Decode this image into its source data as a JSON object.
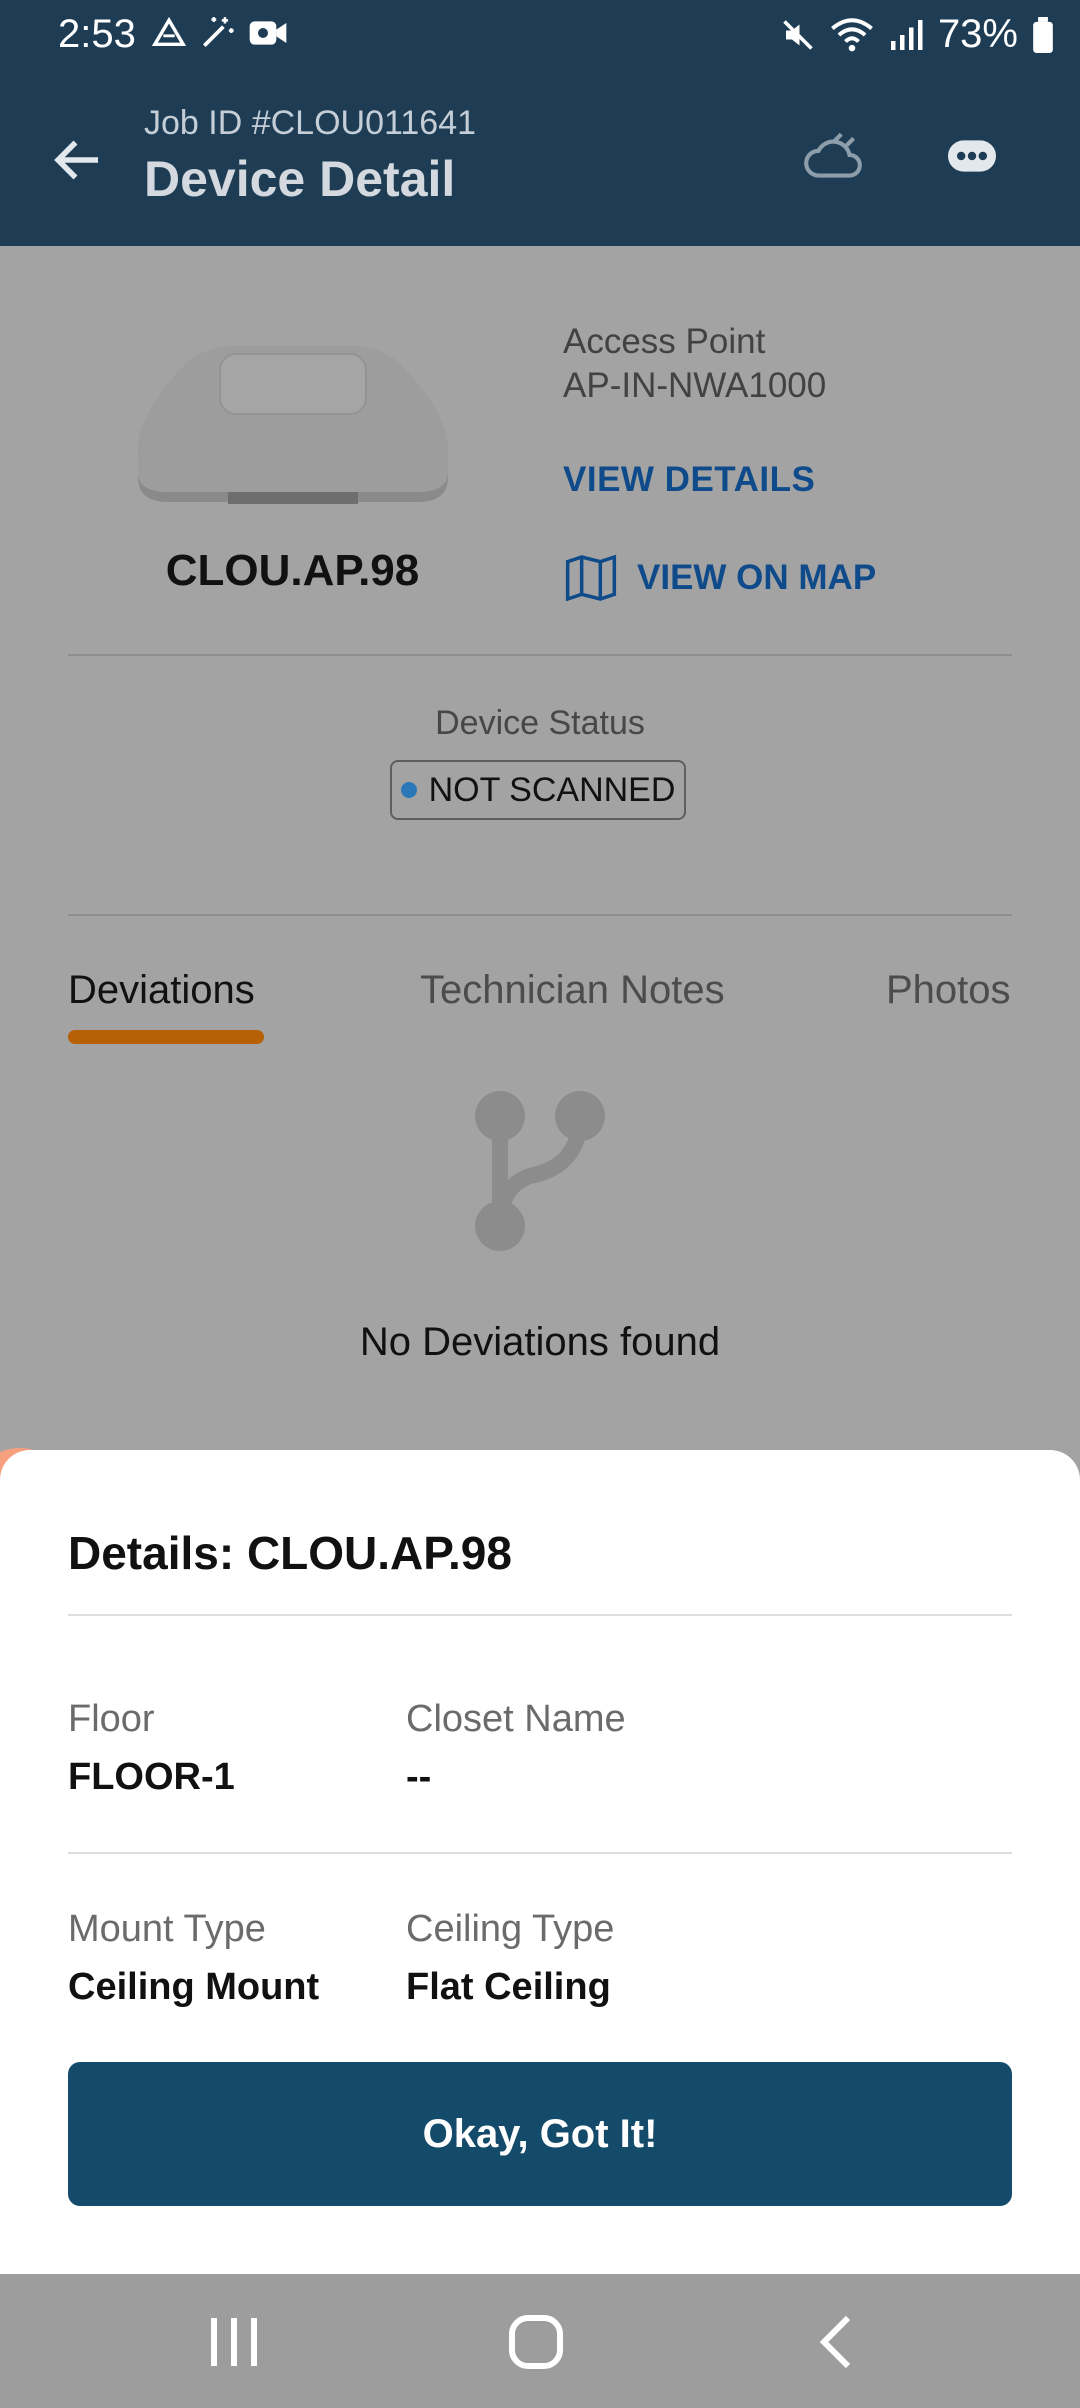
{
  "status_bar": {
    "time": "2:53",
    "battery": "73%"
  },
  "app_bar": {
    "job_id": "Job ID #CLOU011641",
    "title": "Device Detail"
  },
  "device": {
    "type": "Access Point",
    "model": "AP-IN-NWA1000",
    "name": "CLOU.AP.98",
    "view_details": "VIEW DETAILS",
    "view_on_map": "VIEW ON MAP"
  },
  "status": {
    "label": "Device Status",
    "value": "NOT SCANNED",
    "dot_color": "#2b78b8"
  },
  "tabs": [
    {
      "label": "Deviations"
    },
    {
      "label": "Technician Notes"
    },
    {
      "label": "Photos"
    }
  ],
  "empty_state": {
    "text": "No Deviations found"
  },
  "sheet": {
    "title": "Details: CLOU.AP.98",
    "fields": {
      "floor_label": "Floor",
      "floor_value": "FLOOR-1",
      "closet_label": "Closet Name",
      "closet_value": "--",
      "mount_label": "Mount Type",
      "mount_value": "Ceiling Mount",
      "ceiling_label": "Ceiling Type",
      "ceiling_value": "Flat Ceiling"
    },
    "button": "Okay, Got It!"
  },
  "colors": {
    "header": "#1e3d54",
    "accent": "#0f4b8a",
    "tab_indicator": "#b76006",
    "primary_button": "#144a6a"
  }
}
